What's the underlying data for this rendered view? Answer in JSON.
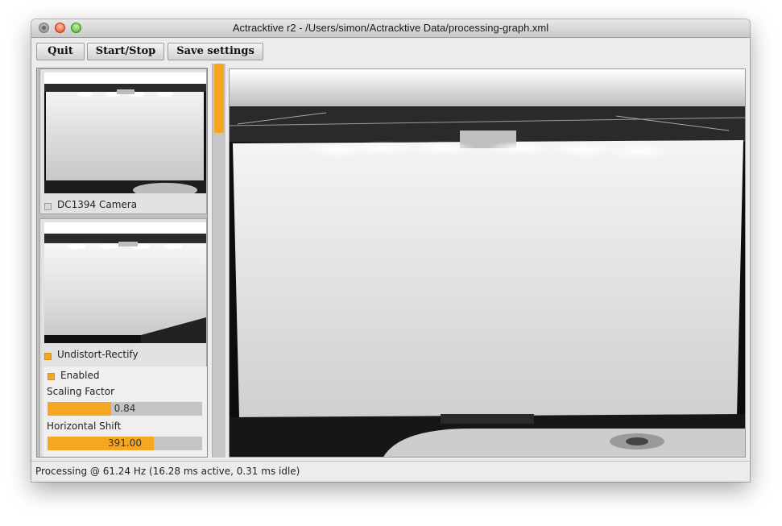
{
  "window": {
    "title": "Actracktive r2 - /Users/simon/Actracktive Data/processing-graph.xml"
  },
  "toolbar": {
    "quit_label": "Quit",
    "startstop_label": "Start/Stop",
    "save_label": "Save settings"
  },
  "nodes": [
    {
      "label": "DC1394 Camera",
      "checked": false
    },
    {
      "label": "Undistort-Rectify",
      "checked": true,
      "enabled_label": "Enabled",
      "enabled": true,
      "params": [
        {
          "label": "Scaling Factor",
          "value": "0.84",
          "fill": 0.41
        },
        {
          "label": "Horizontal Shift",
          "value": "391.00",
          "fill": 0.69
        }
      ]
    }
  ],
  "status": {
    "text": "Processing @ 61.24 Hz (16.28 ms active, 0.31 ms idle)"
  },
  "colors": {
    "accent": "#f5a623",
    "panel_bg": "#ececec"
  }
}
